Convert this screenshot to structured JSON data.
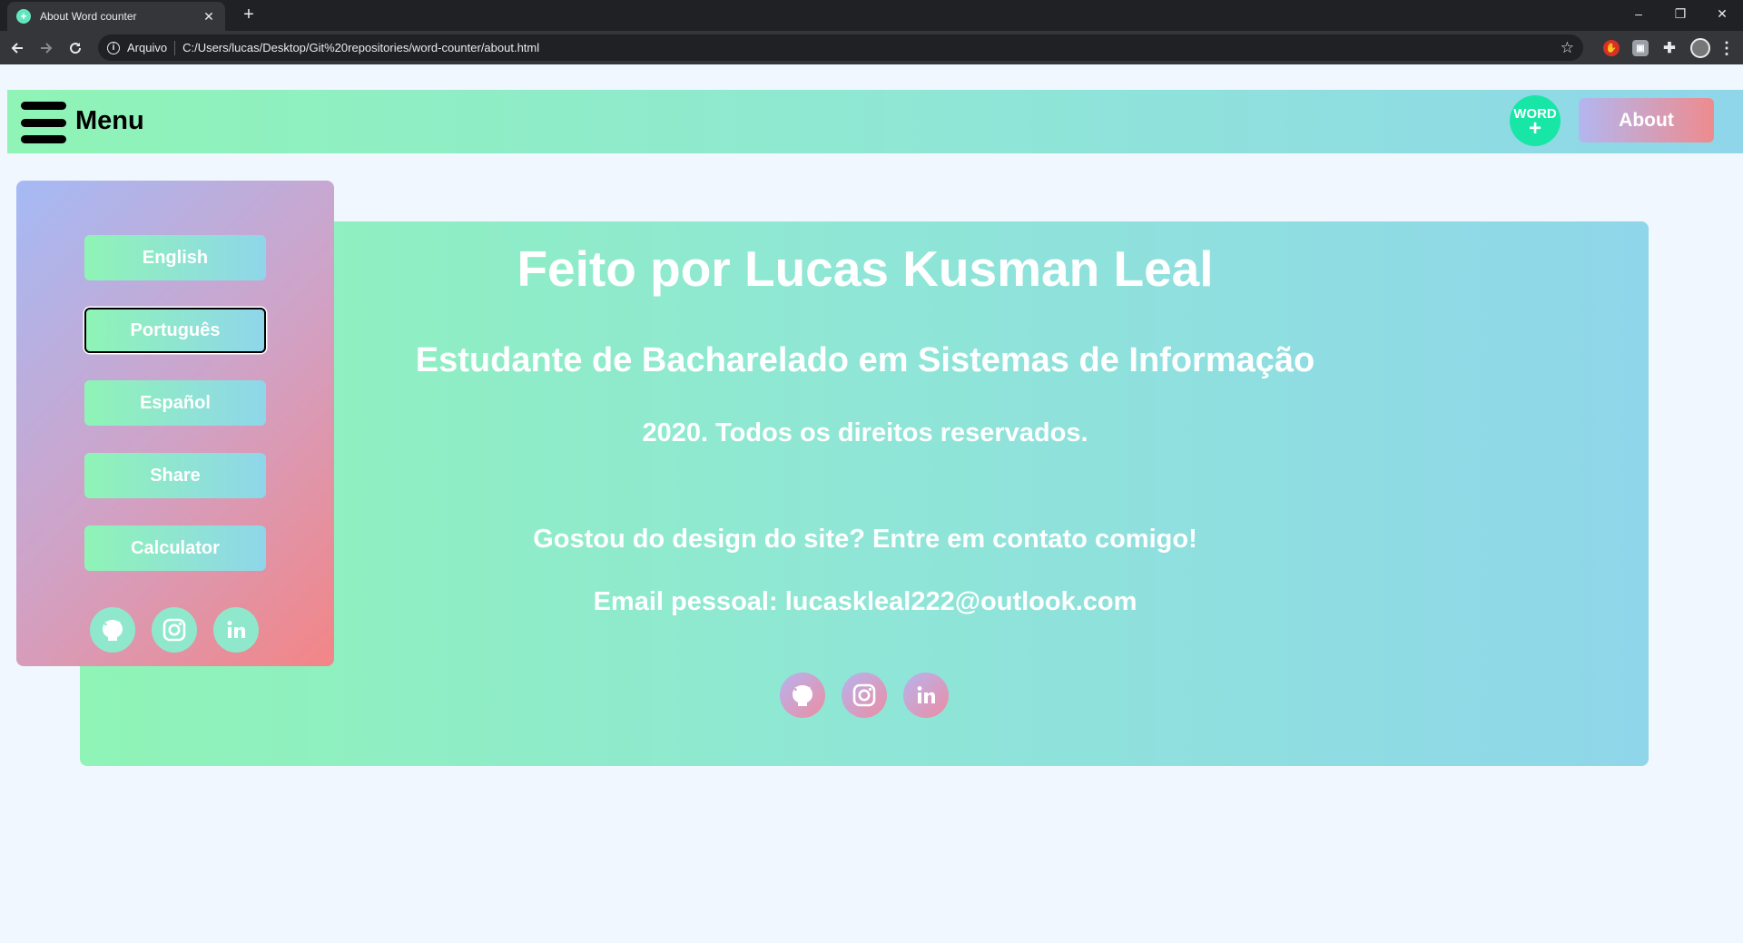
{
  "browser": {
    "tab_title": "About Word counter",
    "tab_close": "✕",
    "new_tab": "+",
    "scheme_label": "Arquivo",
    "url": "C:/Users/lucas/Desktop/Git%20repositories/word-counter/about.html",
    "window_controls": {
      "minimize": "–",
      "restore": "❐",
      "close": "✕"
    }
  },
  "navbar": {
    "menu_label": "Menu",
    "logo_text": "WORD",
    "logo_plus": "+",
    "about_label": "About"
  },
  "sidebar": {
    "items": [
      {
        "label": "English"
      },
      {
        "label": "Português"
      },
      {
        "label": "Español"
      },
      {
        "label": "Share"
      },
      {
        "label": "Calculator"
      }
    ]
  },
  "main": {
    "title": "Feito por Lucas Kusman Leal",
    "subtitle": "Estudante de Bacharelado em Sistemas de Informação",
    "copyright": "2020. Todos os direitos reservados.",
    "contact": "Gostou do design do site? Entre em contato comigo!",
    "email": "Email pessoal: lucaskleal222@outlook.com"
  },
  "social_links": [
    "github-icon",
    "instagram-icon",
    "linkedin-icon"
  ],
  "colors": {
    "gradient_green": "#8ff4b6",
    "gradient_blue": "#8fd6ea",
    "gradient_lavender": "#a5baf5",
    "gradient_coral": "#f38586",
    "page_background": "#f0f7fe",
    "logo": "#18e6a6"
  }
}
